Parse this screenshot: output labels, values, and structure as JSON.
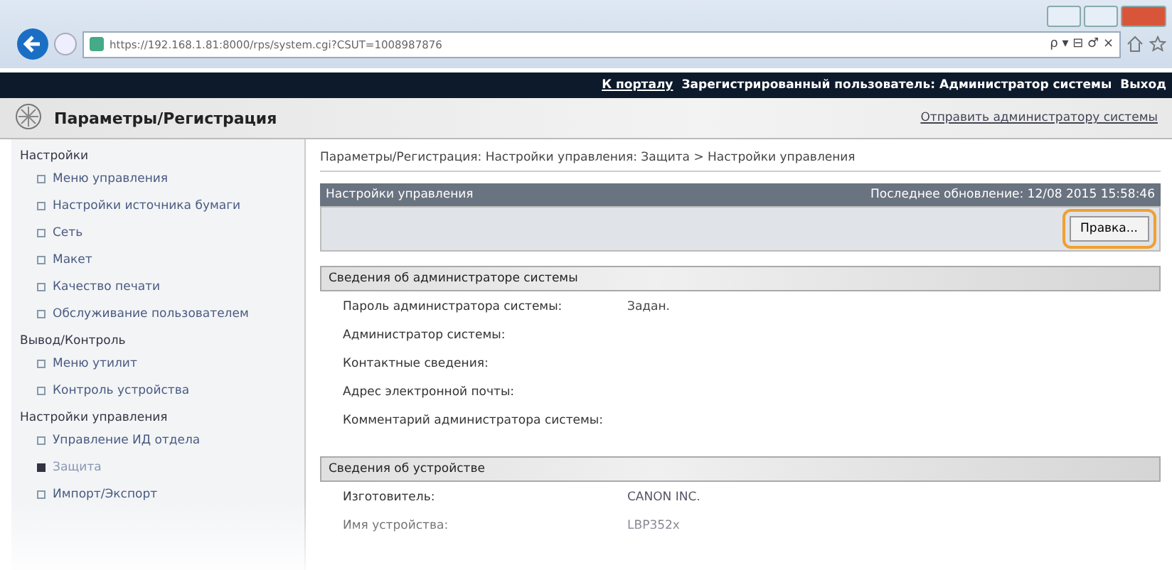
{
  "browser": {
    "address": "https://192.168.1.81:8000/rps/system.cgi?CSUT=1008987876",
    "search_hint": "ρ ▾ ⊟ ♂ ×"
  },
  "top_bar": {
    "portal_link": "К порталу",
    "user": "Зарегистрированный пользователь: Администратор системы",
    "logout": "Выход"
  },
  "title_bar": {
    "title": "Параметры/Регистрация",
    "send_link": "Отправить администратору системы"
  },
  "sidebar": [
    {
      "heading": "Настройки",
      "items": [
        {
          "label": "Меню управления",
          "selected": false
        },
        {
          "label": "Настройки источника бумаги",
          "selected": false
        },
        {
          "label": "Сеть",
          "selected": false
        },
        {
          "label": "Макет",
          "selected": false
        },
        {
          "label": "Качество печати",
          "selected": false
        },
        {
          "label": "Обслуживание пользователем",
          "selected": false
        }
      ]
    },
    {
      "heading": "Вывод/Контроль",
      "items": [
        {
          "label": "Меню утилит",
          "selected": false
        },
        {
          "label": "Контроль устройства",
          "selected": false
        }
      ]
    },
    {
      "heading": "Настройки управления",
      "items": [
        {
          "label": "Управление ИД отдела",
          "selected": false
        },
        {
          "label": "Защита",
          "selected": true
        },
        {
          "label": "Импорт/Экспорт",
          "selected": false
        }
      ]
    }
  ],
  "breadcrumb": "Параметры/Регистрация: Настройки управления: Защита > Настройки управления",
  "panel": {
    "title": "Настройки управления",
    "updated": "Последнее обновление: 12/08 2015 15:58:46",
    "edit_button": "Правка..."
  },
  "sections": [
    {
      "title": "Сведения об администраторе системы",
      "rows": [
        {
          "label": "Пароль администратора системы:",
          "value": "Задан."
        },
        {
          "label": "Администратор системы:"
        },
        {
          "label": "Контактные сведения:"
        },
        {
          "label": "Адрес электронной почты:"
        },
        {
          "label": "Комментарий администратора системы:"
        }
      ]
    },
    {
      "title": "Сведения об устройстве",
      "rows": [
        {
          "label": "Изготовитель:",
          "value": "CANON INC."
        },
        {
          "label": "Имя устройства:",
          "value": "LBP352x"
        }
      ]
    }
  ]
}
